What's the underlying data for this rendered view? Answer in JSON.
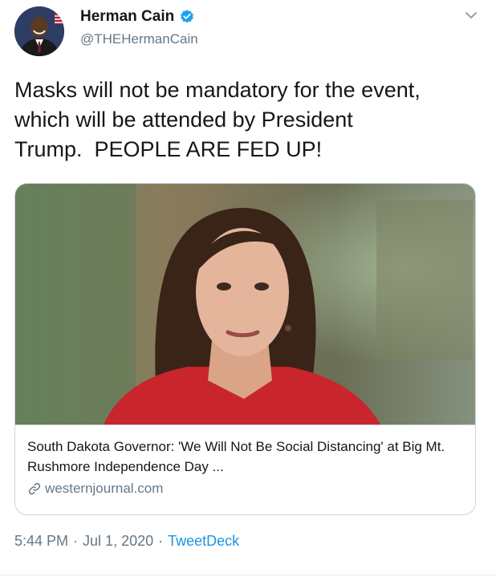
{
  "author": {
    "display_name": "Herman Cain",
    "handle": "@THEHermanCain",
    "verified": true,
    "avatar_icon": "profile-photo"
  },
  "tweet": {
    "text": "Masks will not be mandatory for the event,\nwhich will be attended by President\nTrump.  PEOPLE ARE FED UP!"
  },
  "card": {
    "image_icon": "news-photo",
    "title": "South Dakota Governor: 'We Will Not Be Social Distancing' at Big Mt. Rushmore Independence Day ...",
    "domain": "westernjournal.com",
    "link_icon": "link-icon"
  },
  "meta": {
    "time": "5:44 PM",
    "date": "Jul 1, 2020",
    "separator": "·",
    "source": "TweetDeck"
  },
  "colors": {
    "text": "#14171a",
    "secondary": "#657786",
    "accent": "#1b95e0",
    "border": "#ccd6dd"
  }
}
